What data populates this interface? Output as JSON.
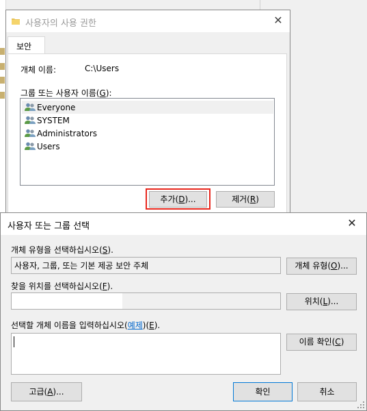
{
  "dialog1": {
    "title": "사용자의 사용 권한",
    "tab_security": "보안",
    "object_name_label": "개체 이름:",
    "object_name_value": "C:\\Users",
    "group_label_pre": "그룹 또는 사용자 이름(",
    "group_label_key": "G",
    "group_label_post": "):",
    "users": [
      {
        "name": "Everyone"
      },
      {
        "name": "SYSTEM"
      },
      {
        "name": "Administrators"
      },
      {
        "name": "Users"
      }
    ],
    "add_button": {
      "pre": "추가(",
      "key": "D",
      "post": ")..."
    },
    "remove_button": {
      "pre": "제거(",
      "key": "R",
      "post": ")"
    }
  },
  "dialog2": {
    "title": "사용자 또는 그룹 선택",
    "object_type_label": {
      "pre": "개체 유형을 선택하십시오(",
      "key": "S",
      "post": ")."
    },
    "object_type_value": "사용자, 그룹, 또는 기본 제공 보안 주체",
    "object_types_button": {
      "pre": "개체 유형(",
      "key": "O",
      "post": ")..."
    },
    "location_label": {
      "pre": "찾을 위치를 선택하십시오(",
      "key": "F",
      "post": ")."
    },
    "location_value": "",
    "location_button": {
      "pre": "위치(",
      "key": "L",
      "post": ")..."
    },
    "names_label": {
      "pre": "선택할 개체 이름을 입력하십시오(",
      "link": "예제",
      "mid": ")(",
      "key": "E",
      "post": ")."
    },
    "names_value": "",
    "check_names_button": {
      "pre": "이름 확인(",
      "key": "C",
      "post": ")"
    },
    "advanced_button": {
      "pre": "고급(",
      "key": "A",
      "post": ")..."
    },
    "ok_button": "확인",
    "cancel_button": "취소"
  },
  "colors": {
    "dialog_bg": "#f0f0f0",
    "highlight_red": "#e8261c",
    "link_blue": "#0066cc",
    "default_button_border": "#0078d7"
  }
}
